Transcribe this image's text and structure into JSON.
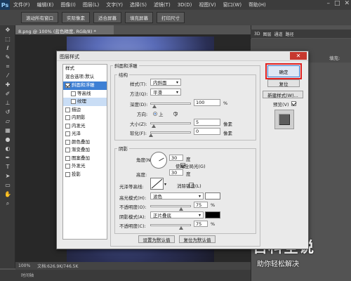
{
  "app": {
    "logo": "Ps",
    "menus": [
      "文件(F)",
      "编辑(E)",
      "图像(I)",
      "图层(L)",
      "文字(Y)",
      "选择(S)",
      "滤镜(T)",
      "3D(D)",
      "视图(V)",
      "窗口(W)",
      "帮助(H)"
    ],
    "option_buttons": [
      "滚动所有窗口",
      "实际像素",
      "适合屏幕",
      "填充屏幕",
      "打印尺寸"
    ],
    "doc_tab": "8.png @ 100% (蓝色精度, RGB/8) *",
    "status": {
      "zoom": "100%",
      "doc": "文档:626.9K/746.5K"
    },
    "bottom_label": "时间轴",
    "panel_tabs": [
      "3D",
      "图层",
      "通道",
      "路径"
    ],
    "panel_fill_label": "填充:",
    "brand": {
      "main": "百科全说",
      "sub": "助你轻松解决"
    }
  },
  "dialog": {
    "title": "图层样式",
    "close": "✕",
    "style_list": [
      {
        "label": "样式",
        "type": "header"
      },
      {
        "label": "混合选项:默认",
        "type": "header"
      },
      {
        "label": "斜面和浮雕",
        "checked": true,
        "selected": true
      },
      {
        "label": "等高线",
        "checked": false,
        "sub": true
      },
      {
        "label": "纹理",
        "checked": false,
        "sub": true,
        "subsel": true
      },
      {
        "label": "描边",
        "checked": false
      },
      {
        "label": "内阴影",
        "checked": false
      },
      {
        "label": "内发光",
        "checked": false
      },
      {
        "label": "光泽",
        "checked": false
      },
      {
        "label": "颜色叠加",
        "checked": false
      },
      {
        "label": "渐变叠加",
        "checked": false
      },
      {
        "label": "图案叠加",
        "checked": false
      },
      {
        "label": "外发光",
        "checked": false
      },
      {
        "label": "投影",
        "checked": false
      }
    ],
    "bevel_title": "斜面和浮雕",
    "structure_title": "结构",
    "style_label": "样式(T):",
    "style_value": "内斜面",
    "method_label": "方法(Q):",
    "method_value": "平滑",
    "depth_label": "深度(D):",
    "depth_value": "100",
    "depth_unit": "%",
    "direction_label": "方向:",
    "dir_up": "上",
    "dir_down": "下",
    "size_label": "大小(Z):",
    "size_value": "5",
    "size_unit": "像素",
    "soften_label": "软化(F):",
    "soften_value": "0",
    "soften_unit": "像素",
    "shading_title": "阴影",
    "angle_label": "角度(N):",
    "angle_value": "30",
    "angle_unit": "度",
    "global_light_label": "使用全局光(G)",
    "altitude_label": "高度:",
    "altitude_value": "30",
    "altitude_unit": "度",
    "gloss_label": "光泽等高线:",
    "antialias_label": "消除锯齿(L)",
    "highlight_label": "高光模式(H):",
    "highlight_value": "滤色",
    "highlight_color": "#ffffff",
    "hl_opacity_label": "不透明度(O):",
    "hl_opacity_value": "75",
    "hl_opacity_unit": "%",
    "shadow_label": "阴影模式(A):",
    "shadow_value": "正片叠底",
    "shadow_color": "#000000",
    "sh_opacity_label": "不透明度(C):",
    "sh_opacity_value": "75",
    "sh_opacity_unit": "%",
    "make_default": "设置为默认值",
    "reset_default": "复位为默认值",
    "ok": "确定",
    "reset": "复位",
    "new_style": "新建样式(W)...",
    "preview_label": "预览(V)"
  }
}
